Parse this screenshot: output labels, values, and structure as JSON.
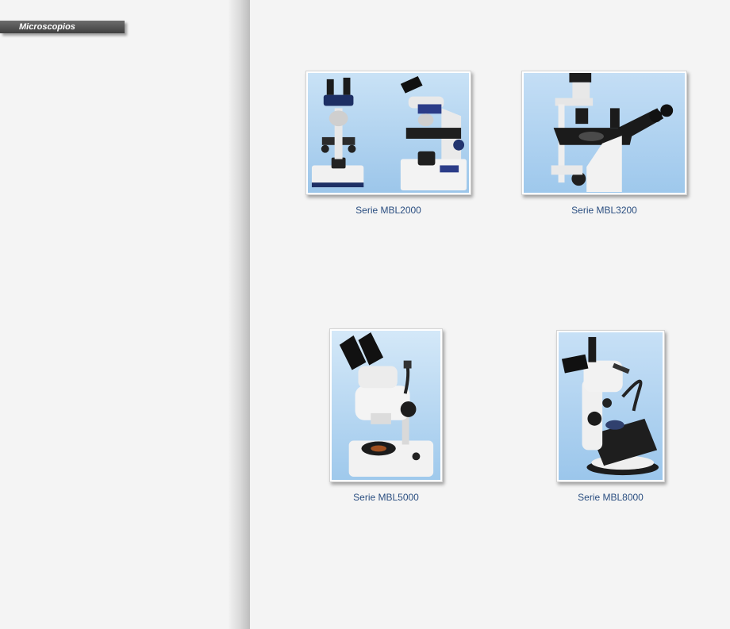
{
  "sidebar": {
    "section_title": "Microscopios"
  },
  "products": [
    {
      "name": "Serie MBL2000",
      "image": "microscope-mbl2000-image"
    },
    {
      "name": "Serie MBL3200",
      "image": "microscope-mbl3200-image"
    },
    {
      "name": "Serie MBL5000",
      "image": "microscope-mbl5000-image"
    },
    {
      "name": "Serie MBL8000",
      "image": "microscope-mbl8000-image"
    }
  ],
  "colors": {
    "page_background": "#f4f4f4",
    "tab_background": "#4a4a4a",
    "caption_text": "#2a4e80",
    "image_background": "#a9cdeb"
  }
}
